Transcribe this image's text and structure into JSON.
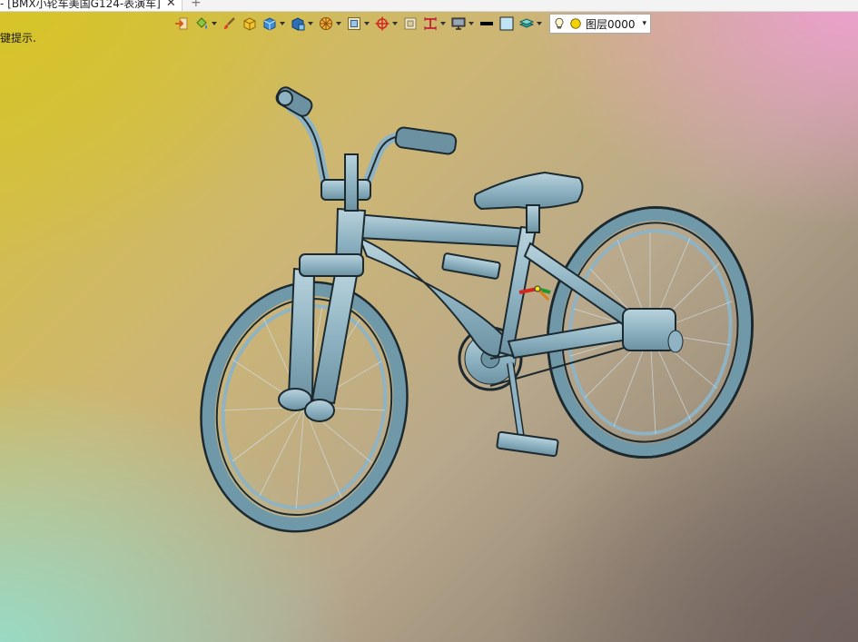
{
  "window": {
    "tab_title": "- [BMX小轮车美国G124-表演车]",
    "close_glyph": "✕",
    "add_glyph": "+"
  },
  "status": {
    "hint_text": "键提示."
  },
  "toolbar": {
    "items": [
      {
        "icon": "import-icon",
        "has_caret": false
      },
      {
        "icon": "paint-bucket-icon",
        "has_caret": true
      },
      {
        "icon": "brush-icon",
        "has_caret": false
      },
      {
        "icon": "box-yellow-icon",
        "has_caret": false
      },
      {
        "icon": "solid-box-icon",
        "has_caret": true
      },
      {
        "icon": "render-box-icon",
        "has_caret": true
      },
      {
        "icon": "wheel-icon",
        "has_caret": true
      },
      {
        "icon": "frame-icon",
        "has_caret": true
      },
      {
        "icon": "target-icon",
        "has_caret": true
      },
      {
        "icon": "square-icon",
        "has_caret": false
      },
      {
        "icon": "measure-icon",
        "has_caret": true
      },
      {
        "icon": "monitor-icon",
        "has_caret": true
      },
      {
        "icon": "line-color-icon",
        "has_caret": false
      },
      {
        "icon": "fill-color-icon",
        "has_caret": false
      },
      {
        "icon": "layers-icon",
        "has_caret": true
      }
    ],
    "layer": {
      "bulb_icon": "lightbulb-icon",
      "dot_icon": "layer-color-dot-icon",
      "label": "图层0000",
      "caret": "▾"
    }
  },
  "viewport": {
    "model": "bicycle-3d-model",
    "colors": {
      "model_fill": "#8fb3c2",
      "model_stroke": "#1c2a30",
      "tire": "#6f98a8"
    }
  }
}
